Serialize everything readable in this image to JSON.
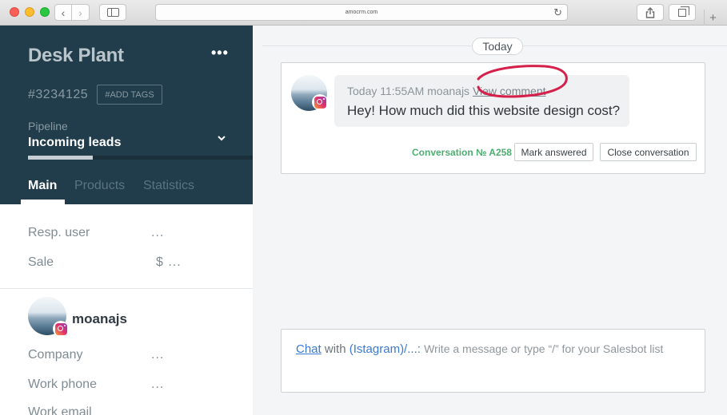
{
  "browser": {
    "url": "amocrm.com"
  },
  "lead": {
    "title": "Desk Plant",
    "id": "#3234125",
    "add_tags": "#ADD TAGS",
    "pipeline_label": "Pipeline",
    "pipeline_value": "Incoming leads",
    "pipeline_progress": 0.29,
    "tabs": [
      {
        "label": "Main"
      },
      {
        "label": "Products"
      },
      {
        "label": "Statistics"
      }
    ],
    "fields": [
      {
        "label": "Resp. user",
        "value": "..."
      },
      {
        "label": "Sale",
        "value": "$ ..."
      }
    ]
  },
  "contact": {
    "name": "moanajs",
    "fields": [
      {
        "label": "Company",
        "value": "..."
      },
      {
        "label": "Work phone",
        "value": "..."
      },
      {
        "label": "Work email",
        "value": ""
      }
    ]
  },
  "feed": {
    "date_label": "Today",
    "message": {
      "time": "Today 11:55AM",
      "author": "moanajs",
      "view_comment": "View comment",
      "text": "Hey! How much did this website design cost?"
    },
    "conversation_number": "Conversation № A258",
    "mark_answered": "Mark answered",
    "close_conversation": "Close conversation"
  },
  "composer": {
    "chat_label": "Chat",
    "with_text": "with",
    "channel": "(Istagram)/...:",
    "placeholder": "Write a message or type “/” for your Salesbot list"
  },
  "colors": {
    "sidebar_bg": "#213d4b",
    "accent_green": "#4fad71",
    "link_blue": "#3a7ad4",
    "annotation_red": "#d4204a"
  }
}
